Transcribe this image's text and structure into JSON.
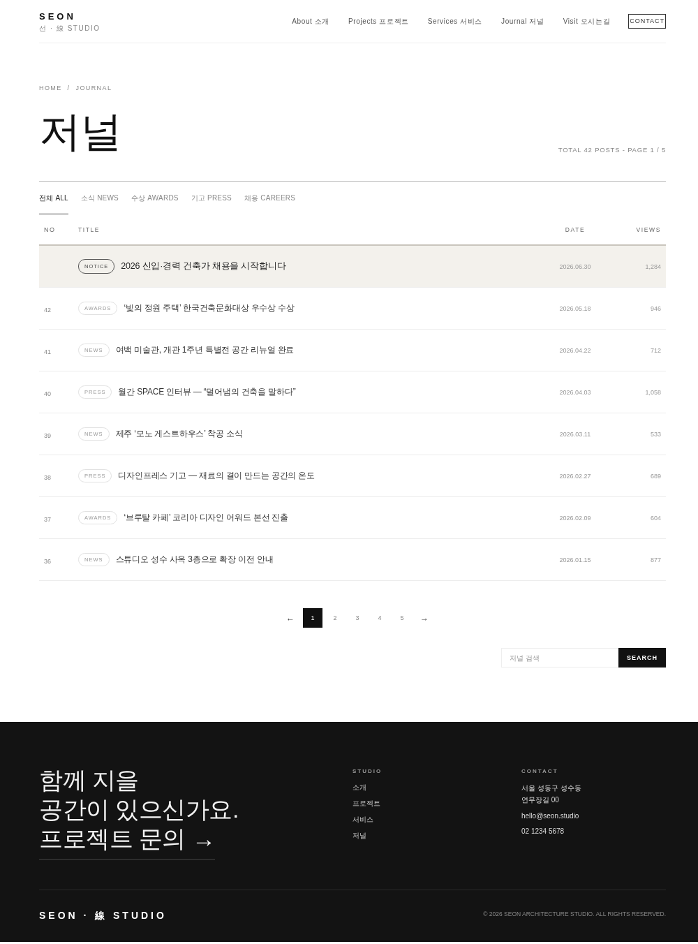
{
  "header": {
    "logo": "SEON",
    "logo_sub": "선 · 線 STUDIO",
    "nav": [
      "About 소개",
      "Projects 프로젝트",
      "Services 서비스",
      "Journal 저널",
      "Visit 오시는길"
    ],
    "contact_button": "CONTACT"
  },
  "breadcrumb": {
    "items": [
      "HOME",
      "JOURNAL"
    ],
    "separator": "/"
  },
  "page_title": "저널",
  "summary": "TOTAL 42 POSTS - PAGE 1 / 5",
  "tabs": [
    {
      "label": "전체 ALL",
      "selected": true
    },
    {
      "label": "소식 NEWS",
      "selected": false
    },
    {
      "label": "수상 AWARDS",
      "selected": false
    },
    {
      "label": "기고 PRESS",
      "selected": false
    },
    {
      "label": "채용 CAREERS",
      "selected": false
    }
  ],
  "table": {
    "columns": [
      "NO",
      "TITLE",
      "DATE",
      "VIEWS"
    ],
    "rows": [
      {
        "kind": "notice",
        "tag": "NOTICE",
        "title": "2026 신입·경력 건축가 채용을 시작합니다",
        "date": "2026.06.30",
        "views": "1,284"
      },
      {
        "kind": "post",
        "no": "42",
        "tag": "AWARDS",
        "title": "‘빛의 정원 주택’ 한국건축문화대상 우수상 수상",
        "date": "2026.05.18",
        "views": "946"
      },
      {
        "kind": "post",
        "no": "41",
        "tag": "NEWS",
        "title": "여백 미술관, 개관 1주년 특별전 공간 리뉴얼 완료",
        "date": "2026.04.22",
        "views": "712"
      },
      {
        "kind": "post",
        "no": "40",
        "tag": "PRESS",
        "title": "월간 SPACE 인터뷰 — “덜어냄의 건축을 말하다”",
        "date": "2026.04.03",
        "views": "1,058"
      },
      {
        "kind": "post",
        "no": "39",
        "tag": "NEWS",
        "title": "제주 ‘모노 게스트하우스’ 착공 소식",
        "date": "2026.03.11",
        "views": "533"
      },
      {
        "kind": "post",
        "no": "38",
        "tag": "PRESS",
        "title": "디자인프레스 기고 — 재료의 결이 만드는 공간의 온도",
        "date": "2026.02.27",
        "views": "689"
      },
      {
        "kind": "post",
        "no": "37",
        "tag": "AWARDS",
        "title": "‘브루탈 카페’ 코리아 디자인 어워드 본선 진출",
        "date": "2026.02.09",
        "views": "604"
      },
      {
        "kind": "post",
        "no": "36",
        "tag": "NEWS",
        "title": "스튜디오 성수 사옥 3층으로 확장 이전 안내",
        "date": "2026.01.15",
        "views": "877"
      }
    ]
  },
  "pagination": {
    "prev": "←",
    "pages": [
      {
        "label": "1",
        "selected": true
      },
      {
        "label": "2",
        "selected": false
      },
      {
        "label": "3",
        "selected": false
      },
      {
        "label": "4",
        "selected": false
      },
      {
        "label": "5",
        "selected": false
      }
    ],
    "next": "→"
  },
  "search": {
    "placeholder": "저널 검색",
    "button": "SEARCH"
  },
  "footer": {
    "headline": [
      "함께 지을",
      "공간이 있으신가요."
    ],
    "cta": "프로젝트 문의 →",
    "studio": {
      "heading": "STUDIO",
      "links": [
        "소개",
        "프로젝트",
        "서비스",
        "저널"
      ]
    },
    "contact": {
      "heading": "CONTACT",
      "address": [
        "서울 성동구 성수동",
        "연무장길 00"
      ],
      "email": "hello@seon.studio",
      "phone": "02 1234 5678"
    },
    "brand": "SEON · 線 STUDIO",
    "copyright": "© 2026 SEON ARCHITECTURE STUDIO. ALL RIGHTS RESERVED."
  }
}
